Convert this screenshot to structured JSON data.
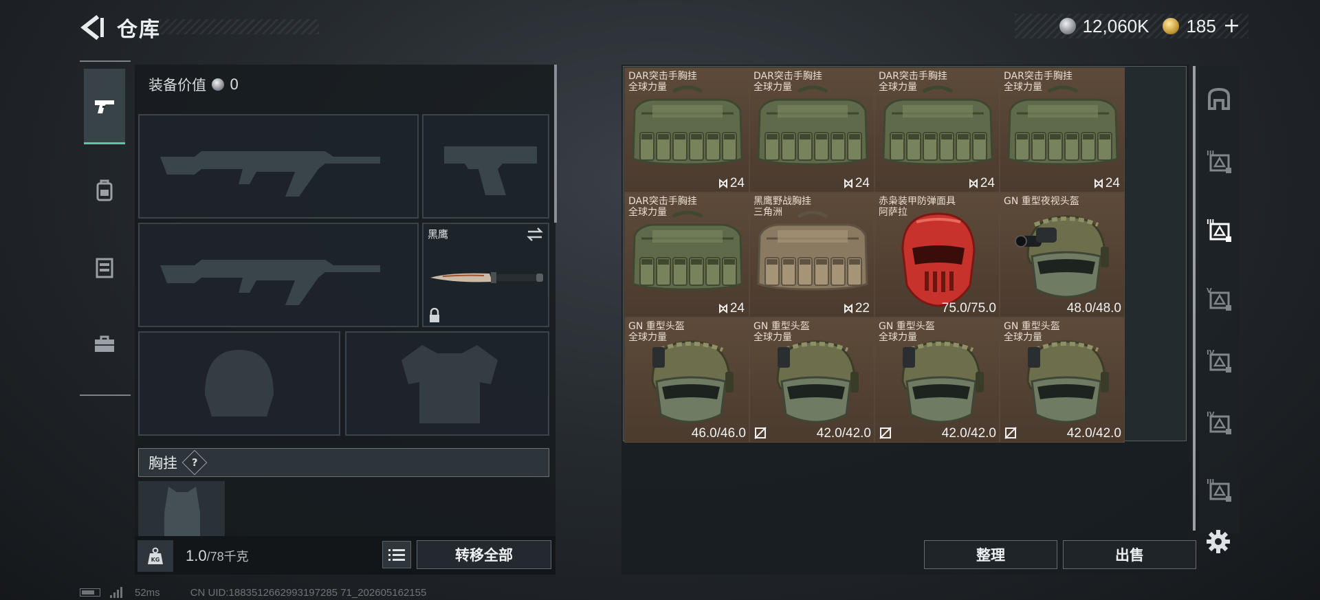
{
  "header": {
    "title": "仓库",
    "currency": [
      {
        "icon": "silver-coin-icon",
        "value": "12,060K"
      },
      {
        "icon": "gold-coin-icon",
        "value": "185"
      }
    ],
    "plus_label": "+"
  },
  "left_tabs": [
    {
      "icon": "pistol-icon",
      "active": true
    },
    {
      "icon": "backpack-icon",
      "active": false
    },
    {
      "icon": "locker-icon",
      "active": false
    },
    {
      "icon": "briefcase-icon",
      "active": false
    }
  ],
  "loadout": {
    "equip_value_label": "装备价值",
    "equip_value": "0",
    "knife_name": "黑鹰",
    "rig_label": "胸挂",
    "help_label": "?",
    "weight_current": "1.0",
    "weight_capacity": "/78千克",
    "transfer_all_label": "转移全部"
  },
  "inventory": {
    "items": [
      {
        "name": "DAR突击手胸挂\n全球力量",
        "kind": "rig",
        "tint": "green",
        "qty": "24"
      },
      {
        "name": "DAR突击手胸挂\n全球力量",
        "kind": "rig",
        "tint": "green",
        "qty": "24"
      },
      {
        "name": "DAR突击手胸挂\n全球力量",
        "kind": "rig",
        "tint": "green",
        "qty": "24"
      },
      {
        "name": "DAR突击手胸挂\n全球力量",
        "kind": "rig",
        "tint": "green",
        "qty": "24"
      },
      {
        "name": "DAR突击手胸挂\n全球力量",
        "kind": "rig",
        "tint": "green",
        "qty": "24"
      },
      {
        "name": "黑鹰野战胸挂\n三角洲",
        "kind": "rig",
        "tint": "tan",
        "qty": "22"
      },
      {
        "name": "赤枭装甲防弹面具\n阿萨拉",
        "kind": "mask",
        "tint": "red",
        "durability": "75.0/75.0"
      },
      {
        "name": "GN 重型夜视头盔",
        "kind": "nvg",
        "tint": "olive",
        "durability": "48.0/48.0"
      },
      {
        "name": "GN 重型头盔\n全球力量",
        "kind": "helmet",
        "tint": "olive",
        "durability": "46.0/46.0"
      },
      {
        "name": "GN 重型头盔\n全球力量",
        "kind": "helmet",
        "tint": "olive",
        "durability": "42.0/42.0",
        "unbreakable_icon": true
      },
      {
        "name": "GN 重型头盔\n全球力量",
        "kind": "helmet",
        "tint": "olive",
        "durability": "42.0/42.0",
        "unbreakable_icon": true
      },
      {
        "name": "GN 重型头盔\n全球力量",
        "kind": "helmet",
        "tint": "olive",
        "durability": "42.0/42.0",
        "unbreakable_icon": true
      }
    ],
    "sort_label": "整理",
    "sell_label": "出售"
  },
  "right_tabs": [
    {
      "icon": "storage-main-icon"
    },
    {
      "icon": "storage-tier3-icon"
    },
    {
      "icon": "storage-tier3-active-icon",
      "active": true
    },
    {
      "icon": "storage-tier5-icon"
    },
    {
      "icon": "storage-tier4-a-icon"
    },
    {
      "icon": "storage-tier4-b-icon"
    },
    {
      "icon": "storage-tier3-b-icon"
    }
  ],
  "status": {
    "ping": "52ms",
    "uid": "CN UID:1883512662993197285 71_202605162155"
  },
  "colors": {
    "accent": "#58c8a8",
    "cell_bg": "#5d4a3a",
    "panel_bg": "#161b1f"
  }
}
